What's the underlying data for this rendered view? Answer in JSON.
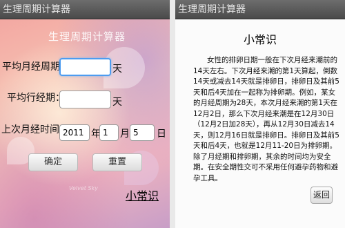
{
  "left_screen": {
    "titlebar": "生理周期计算器",
    "app_title": "生理周期计算器",
    "cycle_label": "平均月经周期:",
    "cycle_value": "",
    "cycle_unit": "天",
    "period_label": "平均行经期：",
    "period_value": "",
    "period_unit": "天",
    "last_label": "上次月经时间:",
    "year_value": "2011",
    "year_unit": "年",
    "month_value": "1",
    "month_unit": "月",
    "day_value": "5",
    "day_unit": "日",
    "ok_button": "确定",
    "reset_button": "重置",
    "watermark": "Velvet Sky",
    "tips_link": "小常识"
  },
  "right_screen": {
    "titlebar": "生理周期计算器",
    "title": "小常识",
    "body": "女性的排卵日期一般在下次月经来潮前的14天左右。下次月经来潮的第1天算起，倒数14天或减去14天就是排卵日，排卵日及其前5天和后4天加在一起称为排卵期。例如，某女的月经周期为28天，本次月经来潮的第1天在12月2日，那么下次月经来潮是在12月30日（12月2日加28天），再从12月30日减去14天，则12月16日就是排卵日。排卵日及其前5天和后4天，也就是12月11-20日为排卵期。除了月经期和排卵期，其余的时间均为安全期。在安全期性交可不采用任何避孕药物和避孕工具。",
    "back_button": "返回"
  }
}
